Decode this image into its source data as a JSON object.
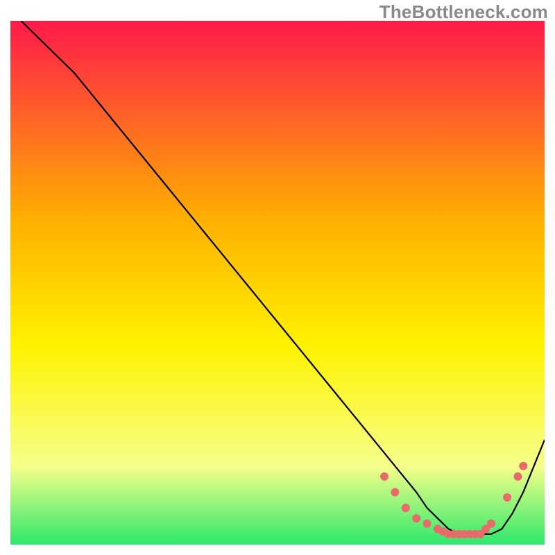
{
  "watermark": "TheBottleneck.com",
  "colors": {
    "gradient_top": "#ff1a4a",
    "gradient_mid1": "#ffb000",
    "gradient_mid2": "#fff200",
    "gradient_mid3": "#f6ff8a",
    "gradient_bottom": "#2ce86a",
    "curve": "#000000",
    "marker": "#e86a6a"
  },
  "chart_data": {
    "type": "line",
    "title": "",
    "xlabel": "",
    "ylabel": "",
    "xlim": [
      0,
      100
    ],
    "ylim": [
      0,
      100
    ],
    "series": [
      {
        "name": "bottleneck-curve",
        "x": [
          2,
          6,
          12,
          20,
          28,
          36,
          44,
          52,
          60,
          68,
          72,
          76,
          78,
          80,
          82,
          84,
          86,
          88,
          90,
          92,
          94,
          96,
          98,
          100
        ],
        "y": [
          100,
          96,
          90,
          80,
          70,
          60,
          50,
          40,
          30,
          20,
          15,
          10,
          7,
          5,
          3,
          2,
          2,
          2,
          2,
          3,
          6,
          10,
          15,
          20
        ]
      }
    ],
    "markers": {
      "name": "valley-markers",
      "points": [
        {
          "x": 70,
          "y": 13
        },
        {
          "x": 72,
          "y": 10
        },
        {
          "x": 74,
          "y": 7
        },
        {
          "x": 76,
          "y": 5
        },
        {
          "x": 78,
          "y": 4
        },
        {
          "x": 80,
          "y": 3
        },
        {
          "x": 81,
          "y": 2.5
        },
        {
          "x": 82,
          "y": 2
        },
        {
          "x": 83,
          "y": 2
        },
        {
          "x": 84,
          "y": 2
        },
        {
          "x": 85,
          "y": 2
        },
        {
          "x": 86,
          "y": 2
        },
        {
          "x": 87,
          "y": 2
        },
        {
          "x": 88,
          "y": 2
        },
        {
          "x": 89,
          "y": 3
        },
        {
          "x": 90,
          "y": 4
        },
        {
          "x": 93,
          "y": 9
        },
        {
          "x": 95,
          "y": 13
        },
        {
          "x": 96,
          "y": 15
        }
      ]
    }
  }
}
